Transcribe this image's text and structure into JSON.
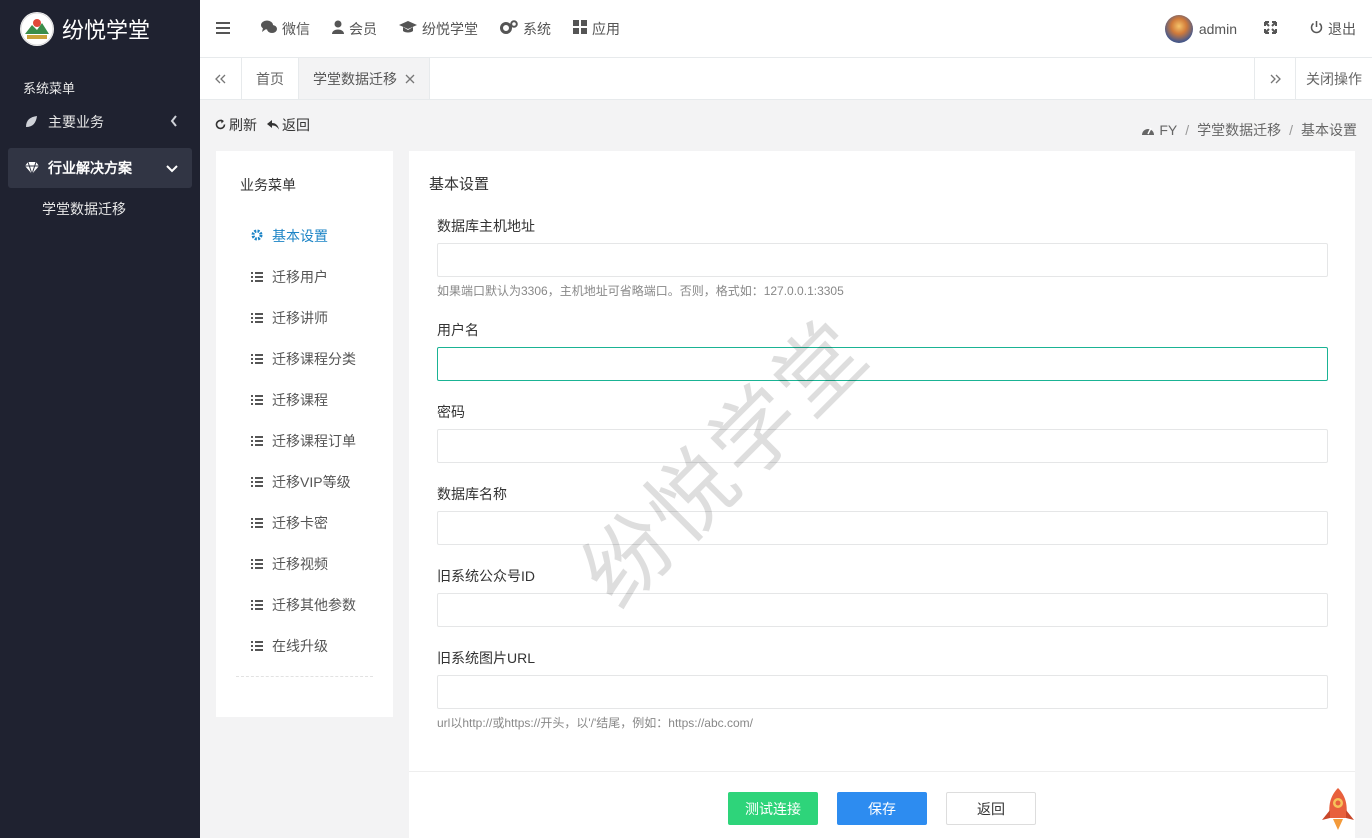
{
  "app": {
    "brand_title": "纷悦学堂",
    "watermark": "纷悦学堂"
  },
  "sidebar": {
    "caption": "系统菜单",
    "items": [
      {
        "label": "主要业务",
        "icon": "leaf-icon"
      },
      {
        "label": "行业解决方案",
        "icon": "diamond-icon"
      }
    ],
    "sub_items": [
      {
        "label": "学堂数据迁移"
      }
    ]
  },
  "topnav": {
    "items": [
      {
        "label": "微信",
        "icon": "comments-icon"
      },
      {
        "label": "会员",
        "icon": "user-icon"
      },
      {
        "label": "纷悦学堂",
        "icon": "graduation-cap-icon"
      },
      {
        "label": "系统",
        "icon": "cogs-icon"
      },
      {
        "label": "应用",
        "icon": "grid-icon"
      }
    ],
    "user": "admin",
    "logout": "退出"
  },
  "tabs": {
    "items": [
      {
        "label": "首页"
      },
      {
        "label": "学堂数据迁移"
      }
    ],
    "close_ops": "关闭操作"
  },
  "toolbar": {
    "refresh": "刷新",
    "back": "返回"
  },
  "breadcrumb": [
    "FY",
    "学堂数据迁移",
    "基本设置"
  ],
  "biz_menu": {
    "title": "业务菜单",
    "items": [
      {
        "label": "基本设置",
        "icon": "gear-icon"
      },
      {
        "label": "迁移用户",
        "icon": "list-icon"
      },
      {
        "label": "迁移讲师",
        "icon": "list-icon"
      },
      {
        "label": "迁移课程分类",
        "icon": "list-icon"
      },
      {
        "label": "迁移课程",
        "icon": "list-icon"
      },
      {
        "label": "迁移课程订单",
        "icon": "list-icon"
      },
      {
        "label": "迁移VIP等级",
        "icon": "list-icon"
      },
      {
        "label": "迁移卡密",
        "icon": "list-icon"
      },
      {
        "label": "迁移视频",
        "icon": "list-icon"
      },
      {
        "label": "迁移其他参数",
        "icon": "list-icon"
      },
      {
        "label": "在线升级",
        "icon": "list-icon"
      }
    ]
  },
  "form": {
    "title": "基本设置",
    "fields": [
      {
        "label": "数据库主机地址",
        "value": "",
        "hint": "如果端口默认为3306，主机地址可省略端口。否则，格式如：127.0.0.1:3305"
      },
      {
        "label": "用户名",
        "value": ""
      },
      {
        "label": "密码",
        "value": ""
      },
      {
        "label": "数据库名称",
        "value": ""
      },
      {
        "label": "旧系统公众号ID",
        "value": ""
      },
      {
        "label": "旧系统图片URL",
        "value": "",
        "hint": "url以http://或https://开头，以'/'结尾，例如：https://abc.com/"
      }
    ],
    "buttons": {
      "test": "测试连接",
      "save": "保存",
      "back": "返回"
    }
  },
  "colors": {
    "sidebar_bg": "#1f2230",
    "accent_blue": "#1c84c6",
    "focus_green": "#1ab394",
    "btn_test": "#2ed47a",
    "btn_save": "#2d8cf0"
  }
}
